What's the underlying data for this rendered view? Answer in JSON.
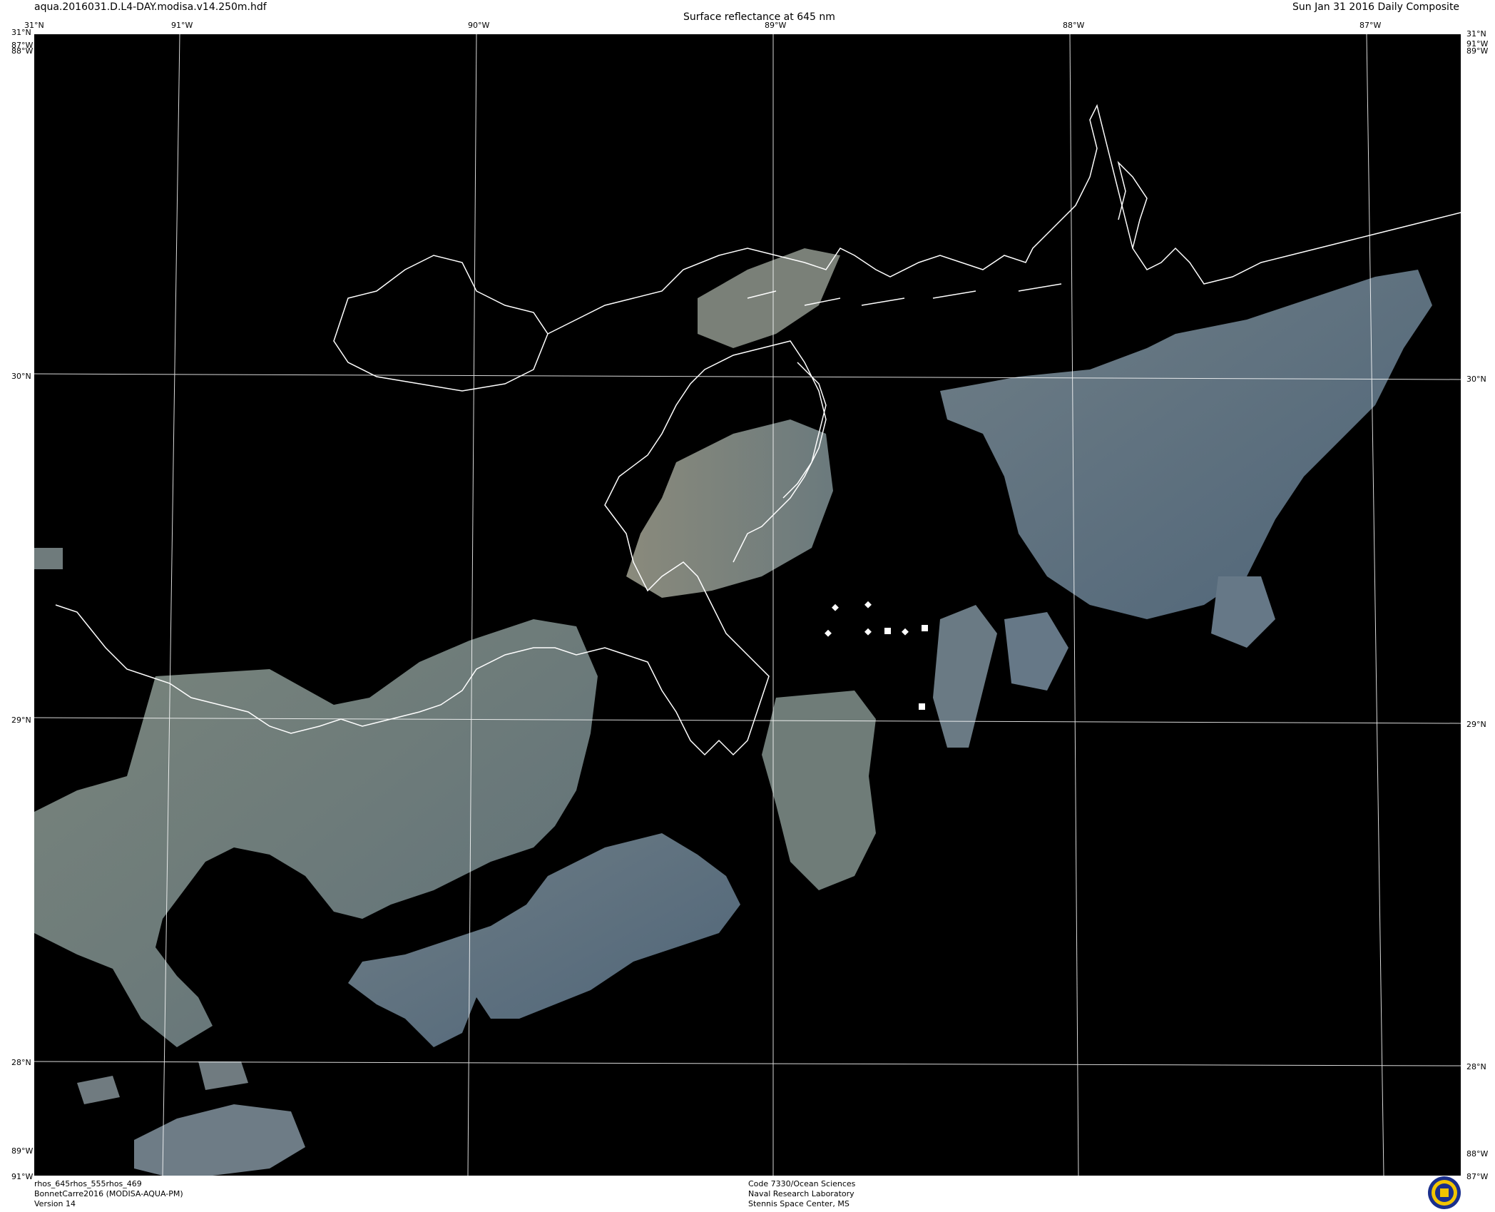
{
  "header": {
    "filename": "aqua.2016031.D.L4-DAY.modisa.v14.250m.hdf",
    "product": "Surface reflectance at 645 nm",
    "date": "Sun Jan 31 2016 Daily Composite"
  },
  "grid": {
    "lon_top": [
      "91°W",
      "90°W",
      "89°W",
      "88°W",
      "87°W"
    ],
    "lat_left": [
      "30°N",
      "29°N",
      "28°N"
    ],
    "lat_right": [
      "30°N",
      "29°N",
      "28°N"
    ],
    "corner_top_left": "31°N",
    "corner_top_left_2": "87°W",
    "corner_top_left_3": "88°W",
    "corner_top_right": "31°N",
    "corner_top_right_2": "91°W",
    "corner_top_right_3": "89°W",
    "corner_bottom_left": "89°W",
    "corner_bottom_left_2": "91°W",
    "corner_bottom_right": "88°W",
    "corner_bottom_right_2": "87°W"
  },
  "footer": {
    "left": [
      "rhos_645rhos_555rhos_469",
      "BonnetCarre2016 (MODISA-AQUA-PM)",
      "Version 14"
    ],
    "center": [
      "Code 7330/Ocean Sciences",
      "Naval Research Laboratory",
      "Stennis Space Center, MS"
    ]
  },
  "map_layers": {
    "ocean_color": "#000000",
    "water_color": "#6f7e7a",
    "coastline_color": "#ffffff",
    "gridline_color": "#ffffff"
  },
  "logo_icon": "nrl-seal-icon"
}
